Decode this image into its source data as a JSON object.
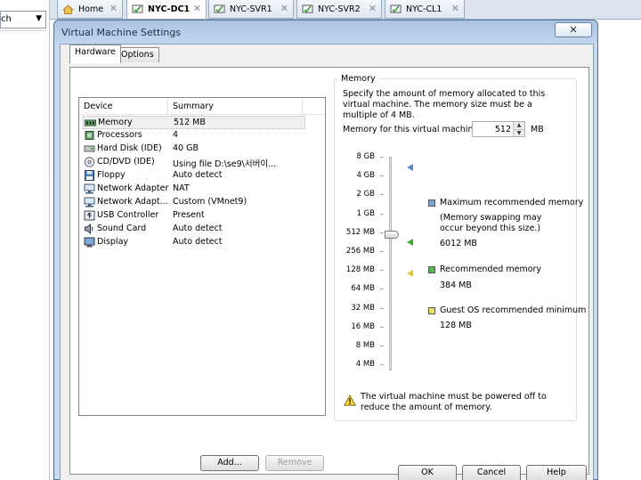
{
  "left_panel": {
    "combo_text": "ch"
  },
  "vm_tabs": [
    {
      "label": "Home",
      "icon": "home-icon"
    },
    {
      "label": "NYC-DC1",
      "icon": "vm-running-icon",
      "active": true
    },
    {
      "label": "NYC-SVR1",
      "icon": "vm-running-icon"
    },
    {
      "label": "NYC-SVR2",
      "icon": "vm-running-icon"
    },
    {
      "label": "NYC-CL1",
      "icon": "vm-running-icon"
    }
  ],
  "dialog": {
    "title": "Virtual Machine Settings",
    "close_glyph": "✕",
    "tabs": [
      {
        "label": "Hardware",
        "active": true
      },
      {
        "label": "Options"
      }
    ]
  },
  "device_list": {
    "columns": [
      "Device",
      "Summary"
    ],
    "rows": [
      {
        "device": "Memory",
        "summary": "512 MB",
        "icon": "memory-icon",
        "selected": true
      },
      {
        "device": "Processors",
        "summary": "4",
        "icon": "cpu-icon"
      },
      {
        "device": "Hard Disk (IDE)",
        "summary": "40 GB",
        "icon": "hard-disk-icon"
      },
      {
        "device": "CD/DVD (IDE)",
        "summary": "Using file D:\\se9\\서버이...",
        "icon": "cd-dvd-icon"
      },
      {
        "device": "Floppy",
        "summary": "Auto detect",
        "icon": "floppy-icon"
      },
      {
        "device": "Network Adapter",
        "summary": "NAT",
        "icon": "network-adapter-icon"
      },
      {
        "device": "Network Adapt...",
        "summary": "Custom (VMnet9)",
        "icon": "network-adapter-icon"
      },
      {
        "device": "USB Controller",
        "summary": "Present",
        "icon": "usb-icon"
      },
      {
        "device": "Sound Card",
        "summary": "Auto detect",
        "icon": "sound-card-icon"
      },
      {
        "device": "Display",
        "summary": "Auto detect",
        "icon": "display-icon"
      }
    ],
    "add_label": "Add...",
    "remove_label": "Remove"
  },
  "memory": {
    "group_label": "Memory",
    "description": "Specify the amount of memory allocated to this virtual machine. The memory size must be a multiple of 4 MB.",
    "field_label": "Memory for this virtual machine:",
    "value": "512",
    "unit": "MB",
    "scale": [
      "8 GB",
      "4 GB",
      "2 GB",
      "1 GB",
      "512 MB",
      "256 MB",
      "128 MB",
      "64 MB",
      "32 MB",
      "16 MB",
      "8 MB",
      "4 MB"
    ],
    "legend": [
      {
        "title": "Maximum recommended memory",
        "note": "(Memory swapping may occur beyond this size.)",
        "value": "6012 MB",
        "color": "#7ea4d4"
      },
      {
        "title": "Recommended memory",
        "note": "",
        "value": "384 MB",
        "color": "#55b84f"
      },
      {
        "title": "Guest OS recommended minimum",
        "note": "",
        "value": "128 MB",
        "color": "#e9e25c"
      }
    ],
    "warning": "The virtual machine must be powered off to reduce the amount of memory."
  },
  "footer": {
    "ok": "OK",
    "cancel": "Cancel",
    "help": "Help"
  }
}
